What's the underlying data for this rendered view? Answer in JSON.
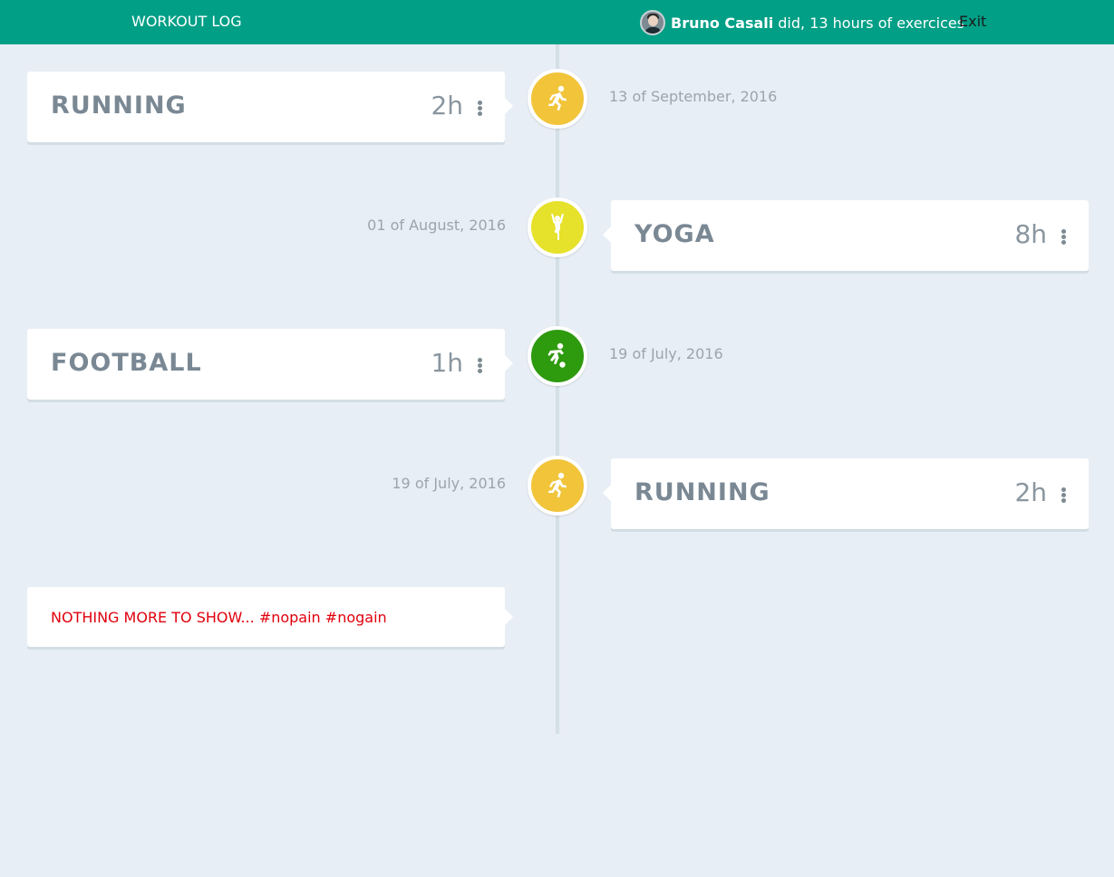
{
  "header": {
    "brand": "WORKOUT LOG",
    "user_name": "Bruno Casali",
    "summary": "did, 13 hours of exercices",
    "exit_label": "Exit"
  },
  "colors": {
    "header": "#009f86",
    "running": "#f1c43a",
    "yoga": "#e6e12a",
    "football": "#2e9a0e",
    "end_text": "#e0000d"
  },
  "entries": [
    {
      "activity": "RUNNING",
      "hours": "2h",
      "date": "13 of September, 2016",
      "icon": "running-icon"
    },
    {
      "activity": "YOGA",
      "hours": "8h",
      "date": "01 of August, 2016",
      "icon": "yoga-icon"
    },
    {
      "activity": "FOOTBALL",
      "hours": "1h",
      "date": "19 of July, 2016",
      "icon": "football-icon"
    },
    {
      "activity": "RUNNING",
      "hours": "2h",
      "date": "19 of July, 2016",
      "icon": "running-icon"
    }
  ],
  "end_message": "NOTHING MORE TO SHOW... #nopain #nogain"
}
